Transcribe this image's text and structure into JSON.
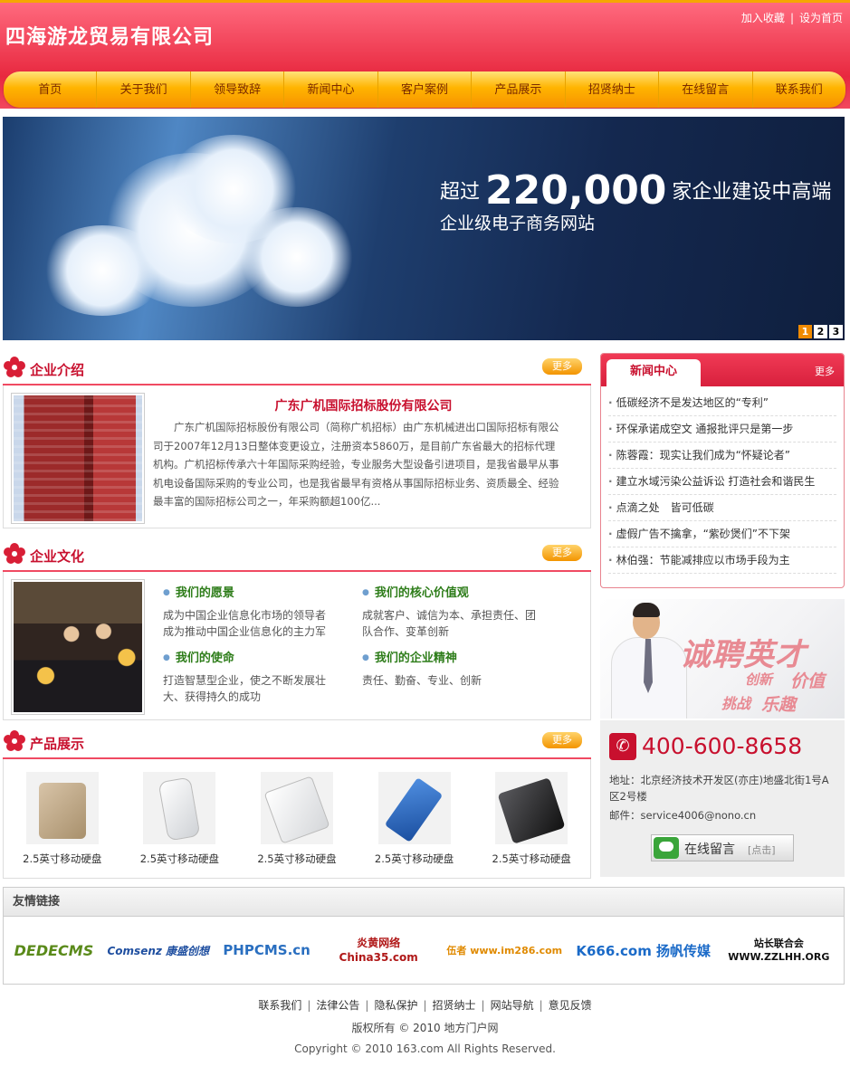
{
  "header": {
    "site_title": "四海游龙贸易有限公司",
    "add_favorite": "加入收藏",
    "set_homepage": "设为首页",
    "separator": "|"
  },
  "nav": [
    "首页",
    "关于我们",
    "领导致辞",
    "新闻中心",
    "客户案例",
    "产品展示",
    "招贤纳士",
    "在线留言",
    "联系我们"
  ],
  "banner": {
    "prefix": "超过",
    "number": "220,000",
    "suffix": "家企业建设中高端",
    "line2": "企业级电子商务网站",
    "pages": [
      "1",
      "2",
      "3"
    ],
    "active_page": "1"
  },
  "intro": {
    "title": "企业介绍",
    "more": "更多",
    "company": "广东广机国际招标股份有限公司",
    "text": "广东广机国际招标股份有限公司（简称广机招标）由广东机械进出口国际招标有限公司于2007年12月13日整体变更设立，注册资本5860万，是目前广东省最大的招标代理机构。广机招标传承六十年国际采购经验，专业服务大型设备引进项目，是我省最早从事机电设备国际采购的专业公司，也是我省最早有资格从事国际招标业务、资质最全、经验最丰富的国际招标公司之一，年采购额超100亿..."
  },
  "culture": {
    "title": "企业文化",
    "more": "更多",
    "items": [
      {
        "title": "我们的愿景",
        "text": "成为中国企业信息化市场的领导者\n成为推动中国企业信息化的主力军"
      },
      {
        "title": "我们的核心价值观",
        "text": "成就客户、诚信为本、承担责任、团队合作、变革创新"
      },
      {
        "title": "我们的使命",
        "text": "打造智慧型企业，使之不断发展壮大、获得持久的成功"
      },
      {
        "title": "我们的企业精神",
        "text": "责任、勤奋、专业、创新"
      }
    ]
  },
  "products": {
    "title": "产品展示",
    "more": "更多",
    "items": [
      "2.5英寸移动硬盘",
      "2.5英寸移动硬盘",
      "2.5英寸移动硬盘",
      "2.5英寸移动硬盘",
      "2.5英寸移动硬盘"
    ]
  },
  "news": {
    "title": "新闻中心",
    "more": "更多",
    "items": [
      "低碳经济不是发达地区的“专利”",
      "环保承诺成空文 通报批评只是第一步",
      "陈蓉霞：现实让我们成为“怀疑论者”",
      "建立水域污染公益诉讼 打造社会和谐民生",
      "点滴之处　皆可低碳",
      "虚假广告不擒拿，“紫砂煲们”不下架",
      "林伯强：节能减排应以市场手段为主"
    ]
  },
  "recruit": {
    "title": "诚聘英才",
    "words": [
      "创新",
      "价值",
      "挑战",
      "乐趣"
    ]
  },
  "contact": {
    "phone": "400-600-8658",
    "address": "地址：北京经济技术开发区(亦庄)地盛北街1号A区2号楼",
    "email": "邮件：service4006@nono.cn",
    "message_button": "在线留言",
    "message_click": "[点击]"
  },
  "links": {
    "title": "友情链接",
    "logos": [
      {
        "name": "DEDECMS",
        "color": "#5a8a1a"
      },
      {
        "name": "Comsenz 康盛创想",
        "color": "#1f4fa0"
      },
      {
        "name": "PHPCMS.cn",
        "color": "#2a6fc0"
      },
      {
        "name": "炎黄网络 China35.com",
        "color": "#b01818"
      },
      {
        "name": "伍者 www.im286.com",
        "color": "#e08a00"
      },
      {
        "name": "K666.com 扬帆传媒",
        "color": "#1a6ac8"
      },
      {
        "name": "站长联合会 WWW.ZZLHH.ORG",
        "color": "#111111"
      }
    ]
  },
  "footer": {
    "links": [
      "联系我们",
      "法律公告",
      "隐私保护",
      "招贤纳士",
      "网站导航",
      "意见反馈"
    ],
    "copyright": "版权所有 © 2010 地方门户网",
    "copyright_en": "Copyright © 2010 163.com All Rights Reserved."
  },
  "colors": {
    "brand_red": "#e8283f",
    "nav_orange": "#ffb400",
    "title_red": "#c8102e",
    "value_green": "#2e7d1a"
  }
}
